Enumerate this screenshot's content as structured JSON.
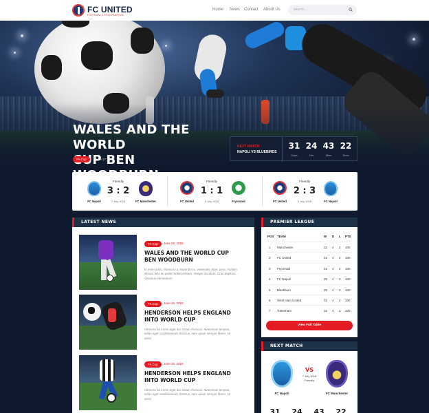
{
  "header": {
    "logo_title": "FC UNITED",
    "logo_subtitle": "FOOTBALL FEDERATION",
    "nav": [
      "Home",
      "News",
      "Contact",
      "About Us"
    ],
    "search_placeholder": "search..."
  },
  "hero": {
    "title_line1": "WALES AND THE WORLD",
    "title_line2": "CUP BEN WOODBURN",
    "tag": "FA Cup",
    "date": "June 17, 2018",
    "countdown": {
      "label": "NEXT MATCH",
      "match": "NAPOLI VS BLUEBIRDS",
      "units": [
        {
          "value": "31",
          "label": "Days"
        },
        {
          "value": "24",
          "label": "Hrs"
        },
        {
          "value": "43",
          "label": "Mins"
        },
        {
          "value": "22",
          "label": "Secs"
        }
      ]
    }
  },
  "results": [
    {
      "competition": "Friendly",
      "score": "3 : 2",
      "date": "7 July 2018",
      "home": "FC Napoli",
      "away": "FC Manchester"
    },
    {
      "competition": "Friendly",
      "score": "1 : 1",
      "date": "5 July 2018",
      "home": "FC United",
      "away": "Fryonraid"
    },
    {
      "competition": "Friendly",
      "score": "2 : 3",
      "date": "5 July 2018",
      "home": "FC United",
      "away": "FC Napoli"
    }
  ],
  "latest_news": {
    "heading": "LATEST NEWS",
    "items": [
      {
        "tag": "FA Cup",
        "date": "June 26, 2018",
        "title_line1": "WALES AND THE WORLD CUP",
        "title_line2": "BEN WOODBURN",
        "body": "In enim justo, rhoncus ut, imperdiet a, venenatis vitae, justo. Nullam dictum felis eu pede mollis pretium. Integer tincidunt. Cras dapibus. Vivamus elementum"
      },
      {
        "tag": "FA Cup",
        "date": "June 26, 2018",
        "title_line1": "HENDERSON HELPS ENGLAND",
        "title_line2": "INTO WORLD CUP",
        "body": "Ultrices nisi lorem eget dui. Etiam rhoncus. Maecenas tempus, tellus eget condimentum rhoncus, sem quam semper libero, sit amet"
      },
      {
        "tag": "FA Cup",
        "date": "June 26, 2018",
        "title_line1": "HENDERSON HELPS ENGLAND",
        "title_line2": "INTO WORLD CUP",
        "body": "Ultrices nisi lorem eget dui. Etiam rhoncus. Maecenas tempus, tellus eget condimentum rhoncus, sem quam semper libero, sit amet"
      }
    ]
  },
  "premier_league": {
    "heading": "PREMIER LEAGUE",
    "columns": [
      "POS",
      "TEAM",
      "W",
      "D",
      "L",
      "PTS"
    ],
    "rows": [
      [
        "1",
        "Manchester",
        "32",
        "4",
        "2",
        "100"
      ],
      [
        "2",
        "FC United",
        "32",
        "4",
        "2",
        "100"
      ],
      [
        "3",
        "Fryonraid",
        "32",
        "4",
        "2",
        "100"
      ],
      [
        "4",
        "FC Napoli",
        "32",
        "4",
        "2",
        "100"
      ],
      [
        "5",
        "Blackburn",
        "32",
        "4",
        "2",
        "100"
      ],
      [
        "6",
        "West Ham United",
        "32",
        "4",
        "2",
        "100"
      ],
      [
        "7",
        "Tottenham",
        "32",
        "4",
        "2",
        "100"
      ]
    ],
    "button": "View Full Table"
  },
  "next_match": {
    "heading": "NEXT MATCH",
    "home": "FC Napoli",
    "away": "FC Manchester",
    "vs": "VS",
    "date": "7 July 2018",
    "competition": "Friendly",
    "countdown": [
      "31",
      "24",
      "43",
      "22"
    ]
  },
  "colors": {
    "accent": "#e31b23",
    "navy": "#1d3247",
    "page_bg": "#0f1a2e"
  }
}
